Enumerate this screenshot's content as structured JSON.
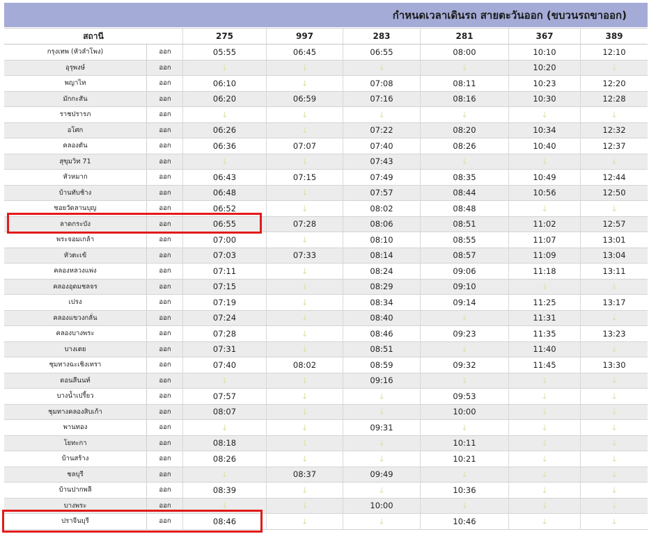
{
  "title": "กำหนดเวลาเดินรถ สายตะวันออก (ขบวนรถขาออก)",
  "headers": {
    "station": "สถานี",
    "trains": [
      "275",
      "997",
      "283",
      "281",
      "367",
      "389"
    ]
  },
  "pass_glyph": "↓",
  "rows": [
    {
      "station": "กรุงเทพ (หัวลำโพง)",
      "dir": "ออก",
      "times": [
        "05:55",
        "06:45",
        "06:55",
        "08:00",
        "10:10",
        "12:10"
      ]
    },
    {
      "station": "อุรุพงษ์",
      "dir": "ออก",
      "times": [
        "↓",
        "↓",
        "↓",
        "↓",
        "10:20",
        "↓"
      ]
    },
    {
      "station": "พญาไท",
      "dir": "ออก",
      "times": [
        "06:10",
        "↓",
        "07:08",
        "08:11",
        "10:23",
        "12:20"
      ]
    },
    {
      "station": "มักกะสัน",
      "dir": "ออก",
      "times": [
        "06:20",
        "06:59",
        "07:16",
        "08:16",
        "10:30",
        "12:28"
      ]
    },
    {
      "station": "ราชปรารภ",
      "dir": "ออก",
      "times": [
        "↓",
        "↓",
        "↓",
        "↓",
        "↓",
        "↓"
      ]
    },
    {
      "station": "อโศก",
      "dir": "ออก",
      "times": [
        "06:26",
        "↓",
        "07:22",
        "08:20",
        "10:34",
        "12:32"
      ]
    },
    {
      "station": "คลองตัน",
      "dir": "ออก",
      "times": [
        "06:36",
        "07:07",
        "07:40",
        "08:26",
        "10:40",
        "12:37"
      ]
    },
    {
      "station": "สุขุมวิท 71",
      "dir": "ออก",
      "times": [
        "↓",
        "↓",
        "07:43",
        "↓",
        "↓",
        "↓"
      ]
    },
    {
      "station": "หัวหมาก",
      "dir": "ออก",
      "times": [
        "06:43",
        "07:15",
        "07:49",
        "08:35",
        "10:49",
        "12:44"
      ]
    },
    {
      "station": "บ้านทับช้าง",
      "dir": "ออก",
      "times": [
        "06:48",
        "↓",
        "07:57",
        "08:44",
        "10:56",
        "12:50"
      ]
    },
    {
      "station": "ซอยวัดลานบุญ",
      "dir": "ออก",
      "times": [
        "06:52",
        "↓",
        "08:02",
        "08:48",
        "↓",
        "↓"
      ]
    },
    {
      "station": "ลาดกระบัง",
      "dir": "ออก",
      "times": [
        "06:55",
        "07:28",
        "08:06",
        "08:51",
        "11:02",
        "12:57"
      ]
    },
    {
      "station": "พระจอมเกล้า",
      "dir": "ออก",
      "times": [
        "07:00",
        "↓",
        "08:10",
        "08:55",
        "11:07",
        "13:01"
      ]
    },
    {
      "station": "หัวตะเข้",
      "dir": "ออก",
      "times": [
        "07:03",
        "07:33",
        "08:14",
        "08:57",
        "11:09",
        "13:04"
      ]
    },
    {
      "station": "คลองหลวงแพ่ง",
      "dir": "ออก",
      "times": [
        "07:11",
        "↓",
        "08:24",
        "09:06",
        "11:18",
        "13:11"
      ]
    },
    {
      "station": "คลองอุดมชลจร",
      "dir": "ออก",
      "times": [
        "07:15",
        "↓",
        "08:29",
        "09:10",
        "↓",
        "↓"
      ]
    },
    {
      "station": "เปรง",
      "dir": "ออก",
      "times": [
        "07:19",
        "↓",
        "08:34",
        "09:14",
        "11:25",
        "13:17"
      ]
    },
    {
      "station": "คลองแขวงกลั่น",
      "dir": "ออก",
      "times": [
        "07:24",
        "↓",
        "08:40",
        "↓",
        "11:31",
        "↓"
      ]
    },
    {
      "station": "คลองบางพระ",
      "dir": "ออก",
      "times": [
        "07:28",
        "↓",
        "08:46",
        "09:23",
        "11:35",
        "13:23"
      ]
    },
    {
      "station": "บางเตย",
      "dir": "ออก",
      "times": [
        "07:31",
        "↓",
        "08:51",
        "↓",
        "11:40",
        "↓"
      ]
    },
    {
      "station": "ชุมทางฉะเชิงเทรา",
      "dir": "ออก",
      "times": [
        "07:40",
        "08:02",
        "08:59",
        "09:32",
        "11:45",
        "13:30"
      ]
    },
    {
      "station": "ดอนสีนนท์",
      "dir": "ออก",
      "times": [
        "↓",
        "↓",
        "09:16",
        "↓",
        "↓",
        "↓"
      ]
    },
    {
      "station": "บางน้ำเปรี้ยว",
      "dir": "ออก",
      "times": [
        "07:57",
        "↓",
        "↓",
        "09:53",
        "↓",
        "↓"
      ]
    },
    {
      "station": "ชุมทางคลองสิบเก้า",
      "dir": "ออก",
      "times": [
        "08:07",
        "↓",
        "↓",
        "10:00",
        "↓",
        "↓"
      ]
    },
    {
      "station": "พานทอง",
      "dir": "ออก",
      "times": [
        "↓",
        "↓",
        "09:31",
        "↓",
        "↓",
        "↓"
      ]
    },
    {
      "station": "โยทะกา",
      "dir": "ออก",
      "times": [
        "08:18",
        "↓",
        "↓",
        "10:11",
        "↓",
        "↓"
      ]
    },
    {
      "station": "บ้านสร้าง",
      "dir": "ออก",
      "times": [
        "08:26",
        "↓",
        "↓",
        "10:21",
        "↓",
        "↓"
      ]
    },
    {
      "station": "ชลบุรี",
      "dir": "ออก",
      "times": [
        "↓",
        "08:37",
        "09:49",
        "↓",
        "↓",
        "↓"
      ]
    },
    {
      "station": "บ้านปากพลี",
      "dir": "ออก",
      "times": [
        "08:39",
        "↓",
        "↓",
        "10:36",
        "↓",
        "↓"
      ]
    },
    {
      "station": "บางพระ",
      "dir": "ออก",
      "times": [
        "↓",
        "↓",
        "10:00",
        "↓",
        "↓",
        "↓"
      ]
    },
    {
      "station": "ปราจีนบุรี",
      "dir": "ออก",
      "times": [
        "08:46",
        "↓",
        "↓",
        "10:46",
        "↓",
        "↓"
      ]
    }
  ],
  "highlights": [
    "ลาดกระบัง",
    "ปราจีนบุรี"
  ]
}
